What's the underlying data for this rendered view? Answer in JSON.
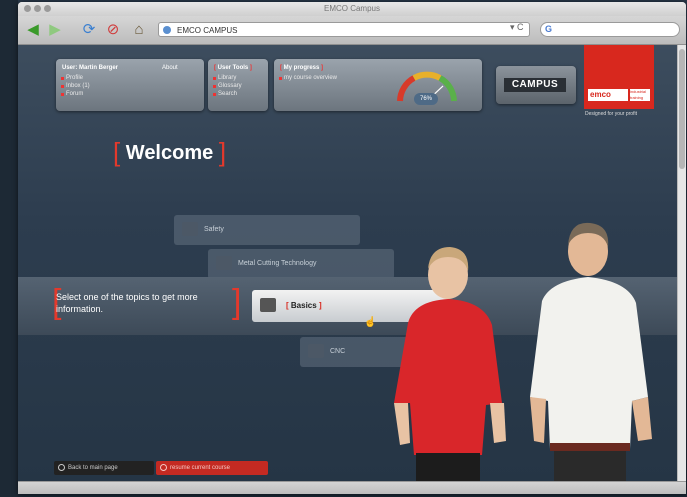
{
  "browser": {
    "window_title": "EMCO Campus",
    "address": "EMCO CAMPUS",
    "address_right": "▾ C",
    "search_engine_icon": "G"
  },
  "header": {
    "user_label": "User: Martin Berger",
    "about_label": "About",
    "user_items": [
      "Profile",
      "Inbox (1)",
      "Forum"
    ],
    "tools_title": "User Tools",
    "tools_items": [
      "Library",
      "Glossary",
      "Search"
    ],
    "progress_title": "My progress",
    "progress_item": "my course overview",
    "progress_value": "76%",
    "progress_fraction": 0.76,
    "campus_button": "CAMPUS",
    "logo_text": "emco",
    "logo_sub": "industrial training",
    "tagline": "Designed for your profit"
  },
  "main": {
    "welcome": "Welcome",
    "instruction": "Select one of the topics to get more information.",
    "topics": [
      {
        "label": "Safety",
        "state": "inactive"
      },
      {
        "label": "Metal Cutting Technology",
        "state": "inactive"
      },
      {
        "label": "Basics",
        "state": "active"
      },
      {
        "label": "CNC",
        "state": "inactive"
      }
    ]
  },
  "footer": {
    "back_label": "Back to main page",
    "resume_label": "resume current course"
  },
  "colors": {
    "accent_red": "#e3392c",
    "logo_red": "#d8281e",
    "page_bg": "#2d3d4f"
  }
}
